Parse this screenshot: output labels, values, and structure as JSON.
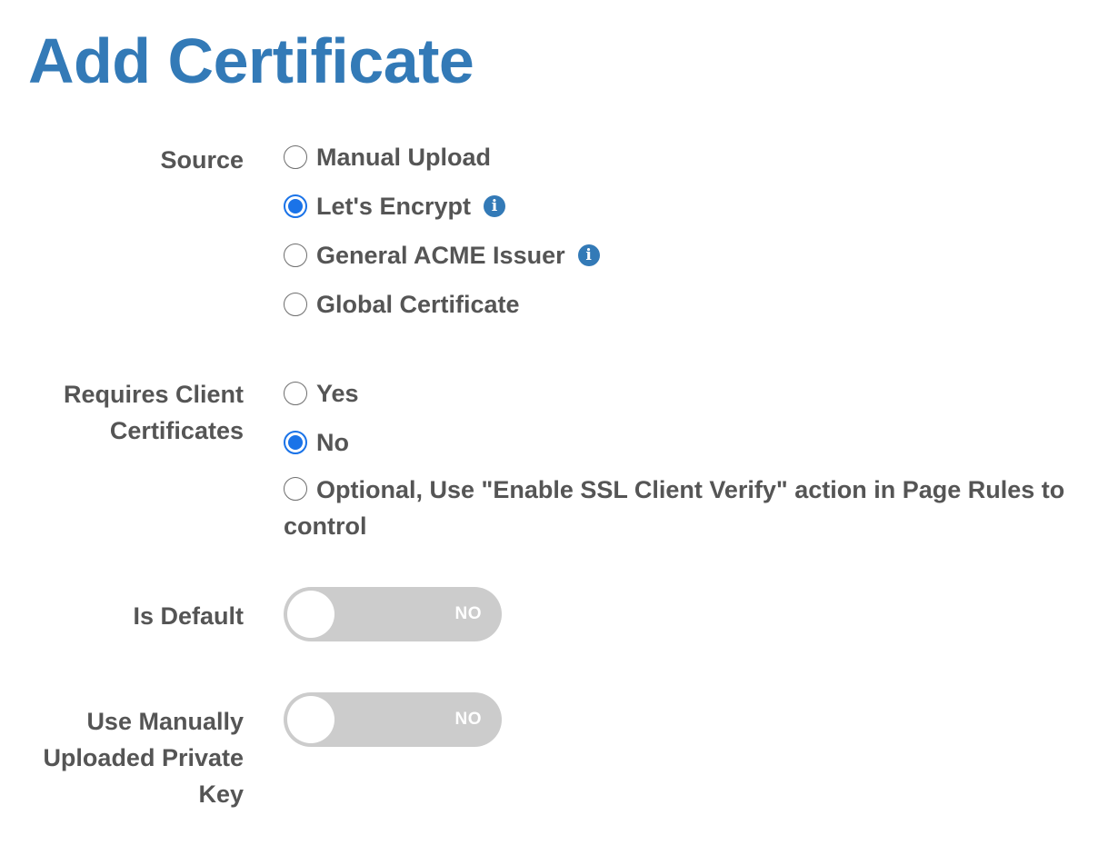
{
  "page": {
    "title": "Add Certificate",
    "accent_color": "#337ab7",
    "radio_checked_color": "#1a73e8",
    "toggle_off_color": "#cccccc"
  },
  "form": {
    "source": {
      "label": "Source",
      "options": [
        {
          "label": "Manual Upload",
          "checked": false,
          "info": false
        },
        {
          "label": "Let's Encrypt",
          "checked": true,
          "info": true
        },
        {
          "label": "General ACME Issuer",
          "checked": false,
          "info": true
        },
        {
          "label": "Global Certificate",
          "checked": false,
          "info": false
        }
      ]
    },
    "client_certs": {
      "label": "Requires Client Certificates",
      "options": [
        {
          "label": "Yes",
          "checked": false
        },
        {
          "label": "No",
          "checked": true
        },
        {
          "label": "Optional, Use \"Enable SSL Client Verify\" action in Page Rules to control",
          "checked": false
        }
      ]
    },
    "is_default": {
      "label": "Is Default",
      "value": "NO",
      "on": false
    },
    "manual_key": {
      "label": "Use Manually Uploaded Private Key",
      "value": "NO",
      "on": false
    }
  },
  "icons": {
    "info": "info-icon",
    "info_glyph": "i"
  }
}
